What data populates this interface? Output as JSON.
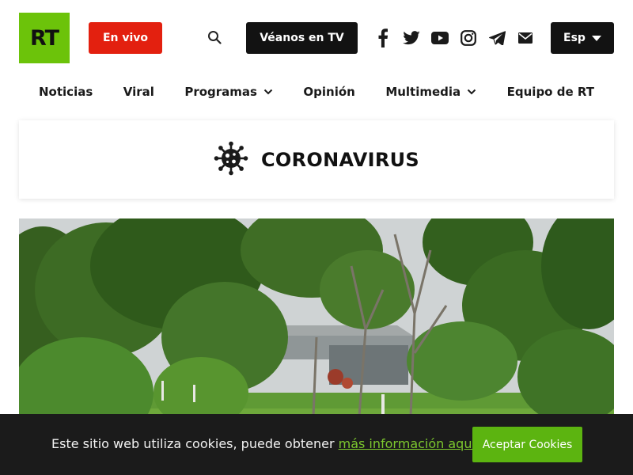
{
  "header": {
    "logo_text": "RT",
    "live_label": "En vivo",
    "tv_label": "Véanos en TV",
    "language_label": "Esp",
    "social_icons": [
      "facebook-icon",
      "twitter-icon",
      "youtube-icon",
      "instagram-icon",
      "telegram-icon",
      "email-icon"
    ],
    "colors": {
      "brand_green": "#6cc30a",
      "live_red": "#e3200f",
      "dark": "#121212"
    }
  },
  "nav": {
    "items": [
      {
        "label": "Noticias",
        "has_dropdown": false
      },
      {
        "label": "Viral",
        "has_dropdown": false
      },
      {
        "label": "Programas",
        "has_dropdown": true
      },
      {
        "label": "Opinión",
        "has_dropdown": false
      },
      {
        "label": "Multimedia",
        "has_dropdown": true
      },
      {
        "label": "Equipo de RT",
        "has_dropdown": false
      }
    ]
  },
  "section": {
    "icon": "virus-icon",
    "title": "CORONAVIRUS"
  },
  "hero": {
    "image": "photo-trees-houses"
  },
  "cookie_bar": {
    "text": "Este sitio web utiliza cookies, puede obtener ",
    "link_text": "más información aquí",
    "accept_label": "Aceptar Cookies",
    "colors": {
      "background": "#1b1b1b",
      "link": "#7cc72e",
      "button": "#5cb410"
    }
  }
}
